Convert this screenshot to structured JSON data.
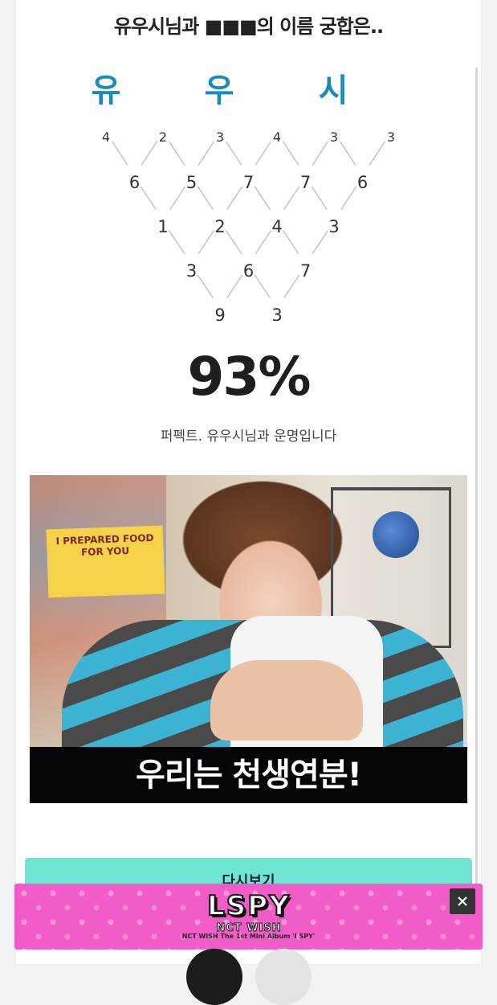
{
  "header": {
    "title": "유우시님과 ■■■의 이름 궁합은.."
  },
  "names": {
    "chars": [
      "유",
      "우",
      "시"
    ]
  },
  "triangle": {
    "rows": [
      [
        4,
        2,
        3,
        4,
        3,
        3
      ],
      [
        6,
        5,
        7,
        7,
        6
      ],
      [
        1,
        2,
        4,
        3
      ],
      [
        3,
        6,
        7
      ],
      [
        9,
        3
      ]
    ]
  },
  "result": {
    "percent": "93%",
    "message": "퍼펙트. 유우시님과 운명입니다"
  },
  "photo": {
    "caption": "우리는 천생연분!",
    "poster_text": "I PREPARED FOOD FOR YOU"
  },
  "actions": {
    "retry_label": "다시보기"
  },
  "ad": {
    "logo_text": "LSPY",
    "logo_sub": "NCT WISH",
    "caption": "NCT WISH The 1st Mini Album 'I SPY'",
    "close_glyph": "✕"
  },
  "colors": {
    "accent_name": "#1a8bb9",
    "button_bg": "#6fe6d3",
    "ad_bg": "#f25cc8"
  }
}
